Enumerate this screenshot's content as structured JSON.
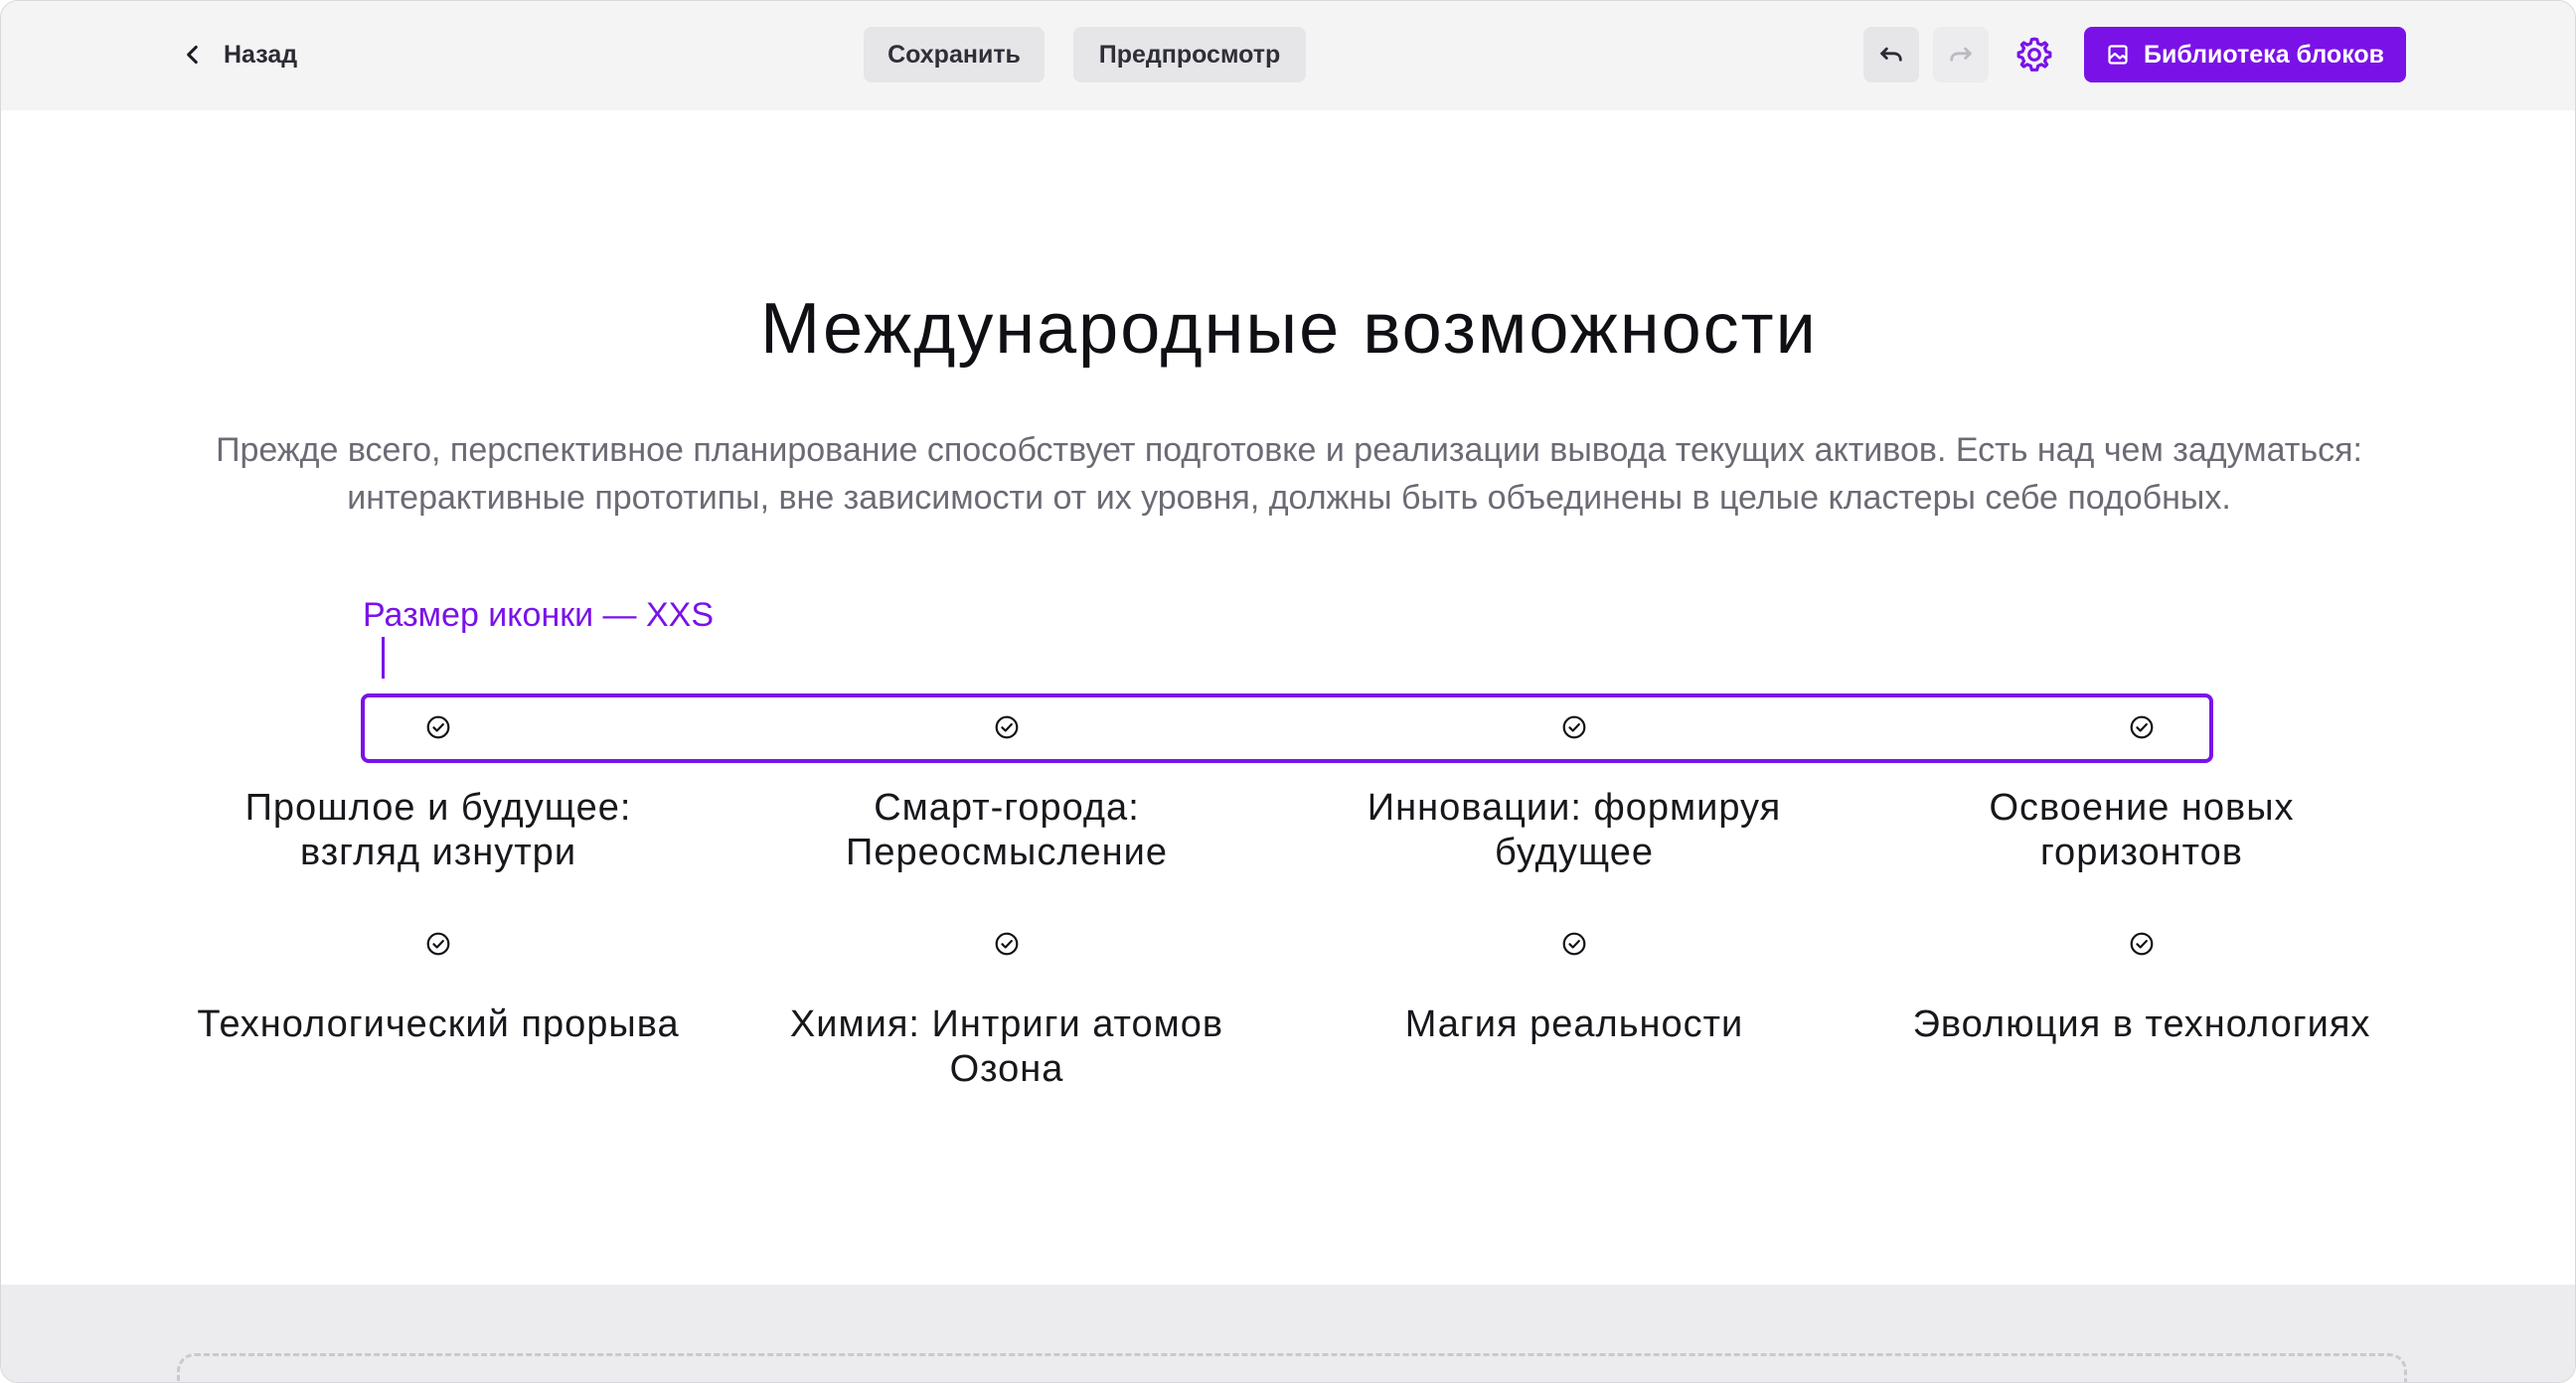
{
  "toolbar": {
    "back_label": "Назад",
    "save_label": "Сохранить",
    "preview_label": "Предпросмотр",
    "library_label": "Библиотека блоков"
  },
  "colors": {
    "accent": "#7a12e8",
    "toolbar_bg": "#f4f4f5",
    "text_muted": "#6b6b75"
  },
  "content": {
    "title": "Международные возможности",
    "lead": "Прежде всего, перспективное планирование способствует подготовке и реализации вывода текущих активов. Есть над чем задуматься: интерактивные прототипы, вне зависимости от их уровня, должны быть объединены в целые кластеры себе подобных.",
    "icon_size_hint": "Размер иконки — XXS"
  },
  "features": {
    "icon": "check-circle-icon",
    "row1": [
      {
        "title": "Прошлое и будущее: взгляд изнутри"
      },
      {
        "title": "Смарт-города: Переосмысление"
      },
      {
        "title": "Инновации: формируя будущее"
      },
      {
        "title": "Освоение новых горизонтов"
      }
    ],
    "row2": [
      {
        "title": "Технологический прорыва"
      },
      {
        "title": "Химия: Интриги атомов Озона"
      },
      {
        "title": "Магия реальности"
      },
      {
        "title": "Эволюция в технологиях"
      }
    ]
  }
}
